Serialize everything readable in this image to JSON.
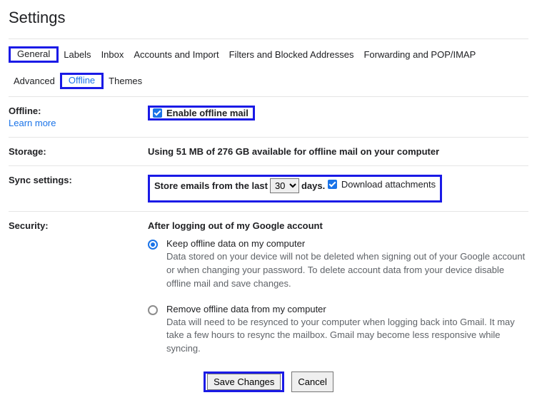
{
  "title": "Settings",
  "tabs_row1": [
    "General",
    "Labels",
    "Inbox",
    "Accounts and Import",
    "Filters and Blocked Addresses",
    "Forwarding and POP/IMAP"
  ],
  "tabs_row2": [
    "Advanced",
    "Offline",
    "Themes"
  ],
  "active_tab": "Offline",
  "offline": {
    "label": "Offline:",
    "learn_more": "Learn more",
    "enable_label": "Enable offline mail"
  },
  "storage": {
    "label": "Storage:",
    "text": "Using 51 MB of 276 GB available for offline mail on your computer"
  },
  "sync": {
    "label": "Sync settings:",
    "store_prefix": "Store emails from the last",
    "store_suffix": "days.",
    "days_value": "30",
    "download_label": "Download attachments"
  },
  "security": {
    "label": "Security:",
    "heading": "After logging out of my Google account",
    "opt_keep_title": "Keep offline data on my computer",
    "opt_keep_desc": "Data stored on your device will not be deleted when signing out of your Google account or when changing your password. To delete account data from your device disable offline mail and save changes.",
    "opt_remove_title": "Remove offline data from my computer",
    "opt_remove_desc": "Data will need to be resynced to your computer when logging back into Gmail. It may take a few hours to resync the mailbox. Gmail may become less responsive while syncing."
  },
  "buttons": {
    "save": "Save Changes",
    "cancel": "Cancel"
  }
}
